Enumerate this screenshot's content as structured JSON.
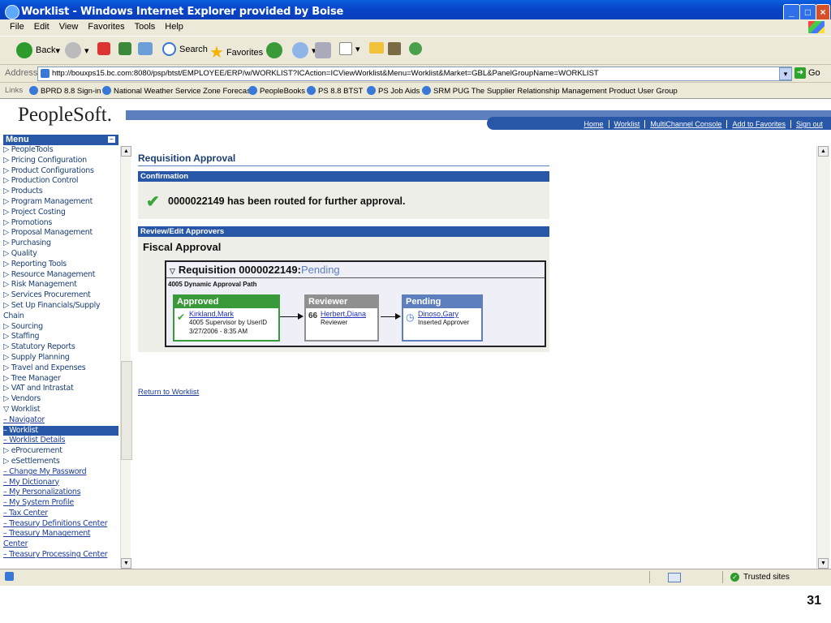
{
  "window": {
    "title": "Worklist - Windows Internet Explorer provided by Boise"
  },
  "menubar": [
    "File",
    "Edit",
    "View",
    "Favorites",
    "Tools",
    "Help"
  ],
  "toolbar": {
    "back": "Back",
    "search": "Search",
    "favorites": "Favorites"
  },
  "address": {
    "label": "Address",
    "url": "http://bouxps15.bc.com:8080/psp/btst/EMPLOYEE/ERP/w/WORKLIST?ICAction=ICViewWorklist&Menu=Worklist&Market=GBL&PanelGroupName=WORKLIST",
    "go": "Go"
  },
  "links": {
    "label": "Links",
    "items": [
      "BPRD 8.8 Sign-in",
      "National Weather Service Zone Forecast",
      "PeopleBooks",
      "PS 8.8 BTST",
      "PS Job Aids",
      "SRM PUG The Supplier Relationship Management Product User Group"
    ]
  },
  "ps": {
    "logo": "PeopleSoft.",
    "nav": [
      "Home",
      "Worklist",
      "MultiChannel Console",
      "Add to Favorites",
      "Sign out"
    ]
  },
  "menu": {
    "title": "Menu",
    "items": [
      {
        "label": "▷ PeopleTools",
        "type": "folder"
      },
      {
        "label": "▷ Pricing Configuration",
        "type": "folder"
      },
      {
        "label": "▷ Product Configurations",
        "type": "folder"
      },
      {
        "label": "▷ Production Control",
        "type": "folder"
      },
      {
        "label": "▷ Products",
        "type": "folder"
      },
      {
        "label": "▷ Program Management",
        "type": "folder"
      },
      {
        "label": "▷ Project Costing",
        "type": "folder"
      },
      {
        "label": "▷ Promotions",
        "type": "folder"
      },
      {
        "label": "▷ Proposal Management",
        "type": "folder"
      },
      {
        "label": "▷ Purchasing",
        "type": "folder"
      },
      {
        "label": "▷ Quality",
        "type": "folder"
      },
      {
        "label": "▷ Reporting Tools",
        "type": "folder"
      },
      {
        "label": "▷ Resource Management",
        "type": "folder"
      },
      {
        "label": "▷ Risk Management",
        "type": "folder"
      },
      {
        "label": "▷ Services Procurement",
        "type": "folder"
      },
      {
        "label": "▷ Set Up Financials/Supply",
        "type": "folder"
      },
      {
        "label": "   Chain",
        "type": "folder"
      },
      {
        "label": "▷ Sourcing",
        "type": "folder"
      },
      {
        "label": "▷ Staffing",
        "type": "folder"
      },
      {
        "label": "▷ Statutory Reports",
        "type": "folder"
      },
      {
        "label": "▷ Supply Planning",
        "type": "folder"
      },
      {
        "label": "▷ Travel and Expenses",
        "type": "folder"
      },
      {
        "label": "▷ Tree Manager",
        "type": "folder"
      },
      {
        "label": "▷ VAT and Intrastat",
        "type": "folder"
      },
      {
        "label": "▷ Vendors",
        "type": "folder"
      },
      {
        "label": "▽ Worklist",
        "type": "folder"
      },
      {
        "label": "  – Navigator",
        "type": "link"
      },
      {
        "label": "  – Worklist",
        "type": "selected"
      },
      {
        "label": "  – Worklist Details",
        "type": "link"
      },
      {
        "label": "▷ eProcurement",
        "type": "folder"
      },
      {
        "label": "▷ eSettlements",
        "type": "folder"
      },
      {
        "label": "– Change My Password",
        "type": "link"
      },
      {
        "label": "– My Dictionary",
        "type": "link"
      },
      {
        "label": "– My Personalizations",
        "type": "link"
      },
      {
        "label": "– My System Profile",
        "type": "link"
      },
      {
        "label": "– Tax Center",
        "type": "link"
      },
      {
        "label": "– Treasury Definitions Center",
        "type": "link"
      },
      {
        "label": "– Treasury Management",
        "type": "link"
      },
      {
        "label": "   Center",
        "type": "link"
      },
      {
        "label": "– Treasury Processing Center",
        "type": "link"
      }
    ]
  },
  "main": {
    "page_title": "Requisition Approval",
    "confirmation_label": "Confirmation",
    "confirmation_msg": "0000022149 has been routed for further approval.",
    "review_label": "Review/Edit Approvers",
    "fiscal": "Fiscal Approval",
    "req_title": "Requisition 0000022149:",
    "req_status": "Pending",
    "path_label": "4005 Dynamic Approval Path",
    "steps": [
      {
        "header": "Approved",
        "name": "Kirkland,Mark",
        "line1": "4005 Supervisor by UserID",
        "line2": "3/27/2006 - 8:35 AM",
        "color": "#3a9a3a"
      },
      {
        "header": "Reviewer",
        "name": "Herbert,Diana",
        "line1": "Reviewer",
        "line2": "",
        "color": "#8f8f8f"
      },
      {
        "header": "Pending",
        "name": "Dinoso,Gary",
        "line1": "Inserted Approver",
        "line2": "",
        "color": "#5d7fbd"
      }
    ],
    "return_link": "Return to Worklist"
  },
  "status": {
    "zone": "Trusted sites"
  },
  "slide_number": "31"
}
